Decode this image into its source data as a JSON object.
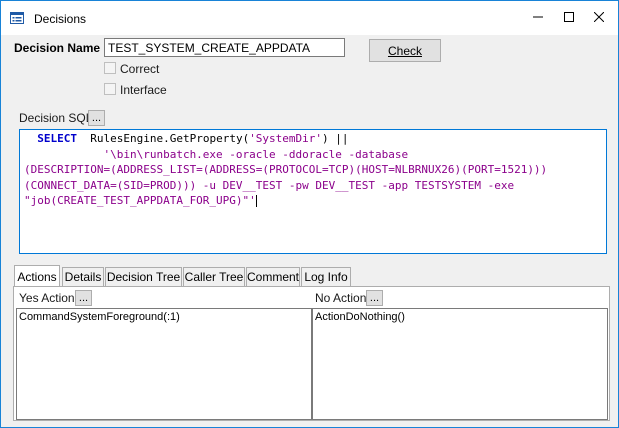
{
  "window": {
    "title": "Decisions",
    "buttons": {
      "minimize": "minimize-icon",
      "maximize": "maximize-icon",
      "close": "close-icon"
    }
  },
  "form": {
    "decision_name_label": "Decision Name",
    "decision_name_value": "TEST_SYSTEM_CREATE_APPDATA",
    "check_button_label": "Check",
    "correct_label": "Correct",
    "correct_checked": false,
    "interface_label": "Interface",
    "interface_checked": false,
    "decision_sql_label": "Decision SQL",
    "ellipsis_label": "..."
  },
  "sql": {
    "line1_kw": "SELECT",
    "line1_fn": "  RulesEngine.GetProperty(",
    "line1_str": "'SystemDir'",
    "line1_end": ") ||",
    "line2": "            '\\bin\\runbatch.exe -oracle -ddoracle -database",
    "line3": "(DESCRIPTION=(ADDRESS_LIST=(ADDRESS=(PROTOCOL=TCP)(HOST=NLBRNUX26)(PORT=1521)))",
    "line4": "(CONNECT_DATA=(SID=PROD))) -u DEV__TEST -pw DEV__TEST -app TESTSYSTEM -exe",
    "line5": "\"job(CREATE_TEST_APPDATA_FOR_UPG)\"'"
  },
  "tabs": [
    {
      "label": "Actions",
      "active": true
    },
    {
      "label": "Details",
      "active": false
    },
    {
      "label": "Decision Tree",
      "active": false
    },
    {
      "label": "Caller Tree",
      "active": false
    },
    {
      "label": "Comment",
      "active": false
    },
    {
      "label": "Log Info",
      "active": false
    }
  ],
  "actions": {
    "yes_label": "Yes Action",
    "no_label": "No Action",
    "yes_items": [
      "CommandSystemForeground(:1)"
    ],
    "no_items": [
      "ActionDoNothing()"
    ]
  },
  "colors": {
    "border_accent": "#1883d7",
    "sql_keyword": "#0000cc",
    "sql_string": "#8b008b"
  }
}
